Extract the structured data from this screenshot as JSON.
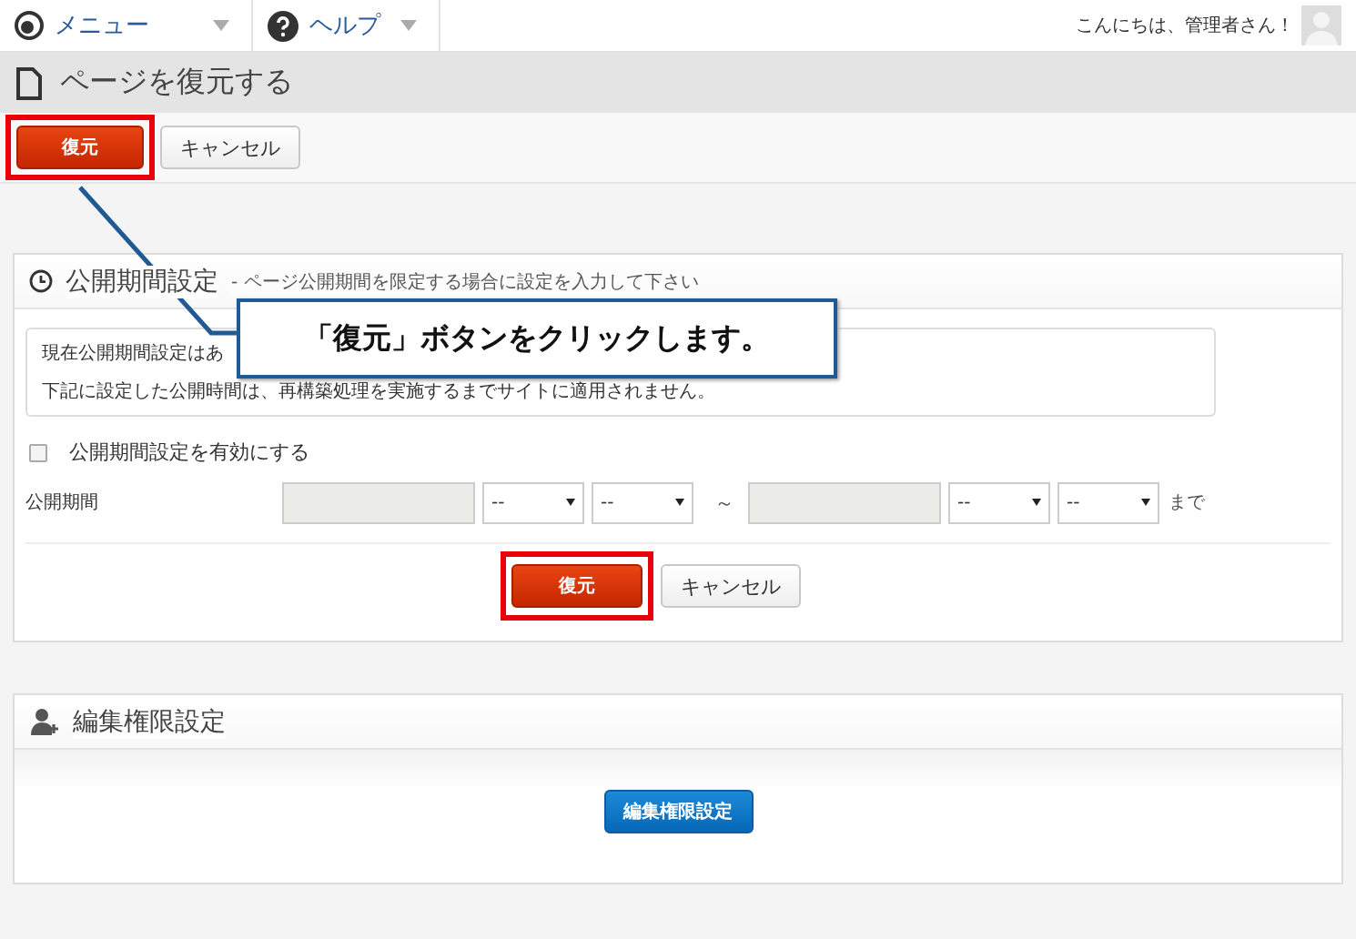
{
  "topbar": {
    "menu": "メニュー",
    "help": "ヘルプ",
    "greeting": "こんにちは、管理者さん！"
  },
  "page_title": "ページを復元する",
  "toolbar": {
    "buttons": [
      {
        "label": "復元",
        "kind": "primary",
        "highlighted": true
      },
      {
        "label": "キャンセル",
        "kind": "default",
        "highlighted": false
      }
    ]
  },
  "publish_section": {
    "title": "公開期間設定",
    "subtitle": "- ページ公開期間を限定する場合に設定を入力して下さい",
    "info": [
      "現在公開期間設定はあ",
      "下記に設定した公開時間は、再構築処理を実施するまでサイトに適用されません。"
    ],
    "enable_checkbox": {
      "label": "公開期間設定を有効にする",
      "checked": false
    },
    "period": {
      "label": "公開期間",
      "start": {
        "hour": "--",
        "minute": "--"
      },
      "separator": "～",
      "end": {
        "hour": "--",
        "minute": "--"
      },
      "suffix": "まで"
    },
    "buttons": [
      {
        "label": "復元",
        "kind": "primary",
        "highlighted": true
      },
      {
        "label": "キャンセル",
        "kind": "default",
        "highlighted": false
      }
    ]
  },
  "permission_section": {
    "title": "編集権限設定",
    "button": "編集権限設定"
  },
  "callout": "「復元」ボタンをクリックします。"
}
